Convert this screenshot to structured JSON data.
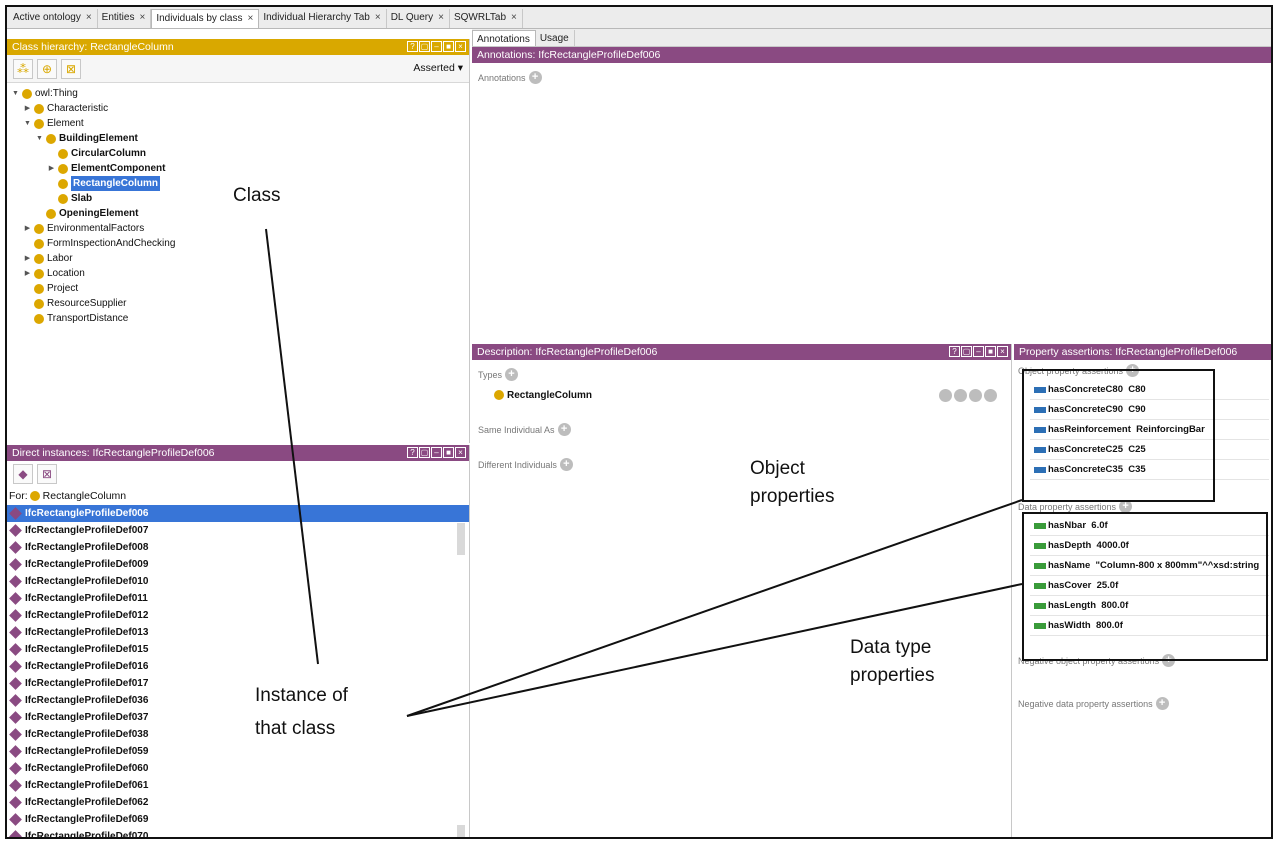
{
  "tabs": [
    {
      "label": "Active ontology"
    },
    {
      "label": "Entities"
    },
    {
      "label": "Individuals by class",
      "active": true
    },
    {
      "label": "Individual Hierarchy Tab"
    },
    {
      "label": "DL Query"
    },
    {
      "label": "SQWRLTab"
    }
  ],
  "tab_close_glyph": "×",
  "class_hierarchy": {
    "title": "Class hierarchy: RectangleColumn",
    "asserted": "Asserted ▾",
    "tree": [
      {
        "label": "owl:Thing",
        "level": 0,
        "toggle": "▼"
      },
      {
        "label": "Characteristic",
        "level": 1,
        "toggle": "▶"
      },
      {
        "label": "Element",
        "level": 1,
        "toggle": "▼"
      },
      {
        "label": "BuildingElement",
        "level": 2,
        "toggle": "▼",
        "bold": true
      },
      {
        "label": "CircularColumn",
        "level": 3,
        "bold": true
      },
      {
        "label": "ElementComponent",
        "level": 3,
        "toggle": "▶",
        "bold": true
      },
      {
        "label": "RectangleColumn",
        "level": 3,
        "bold": true,
        "selected": true
      },
      {
        "label": "Slab",
        "level": 3,
        "bold": true
      },
      {
        "label": "OpeningElement",
        "level": 2,
        "bold": true
      },
      {
        "label": "EnvironmentalFactors",
        "level": 1,
        "toggle": "▶"
      },
      {
        "label": "FormInspectionAndChecking",
        "level": 1
      },
      {
        "label": "Labor",
        "level": 1,
        "toggle": "▶"
      },
      {
        "label": "Location",
        "level": 1,
        "toggle": "▶"
      },
      {
        "label": "Project",
        "level": 1
      },
      {
        "label": "ResourceSupplier",
        "level": 1
      },
      {
        "label": "TransportDistance",
        "level": 1
      }
    ]
  },
  "direct_instances": {
    "title": "Direct instances: IfcRectangleProfileDef006",
    "for_label": "For:",
    "for_class": "RectangleColumn",
    "items": [
      "IfcRectangleProfileDef006",
      "IfcRectangleProfileDef007",
      "IfcRectangleProfileDef008",
      "IfcRectangleProfileDef009",
      "IfcRectangleProfileDef010",
      "IfcRectangleProfileDef011",
      "IfcRectangleProfileDef012",
      "IfcRectangleProfileDef013",
      "IfcRectangleProfileDef015",
      "IfcRectangleProfileDef016",
      "IfcRectangleProfileDef017",
      "IfcRectangleProfileDef036",
      "IfcRectangleProfileDef037",
      "IfcRectangleProfileDef038",
      "IfcRectangleProfileDef059",
      "IfcRectangleProfileDef060",
      "IfcRectangleProfileDef061",
      "IfcRectangleProfileDef062",
      "IfcRectangleProfileDef069",
      "IfcRectangleProfileDef070"
    ],
    "selected_index": 0
  },
  "annotations": {
    "tab1": "Annotations",
    "tab2": "Usage",
    "title": "Annotations: IfcRectangleProfileDef006",
    "label": "Annotations"
  },
  "description": {
    "title": "Description: IfcRectangleProfileDef006",
    "types_label": "Types",
    "type_value": "RectangleColumn",
    "same_label": "Same Individual As",
    "different_label": "Different Individuals"
  },
  "property_assertions": {
    "title": "Property assertions: IfcRectangleProfileDef006",
    "object_label": "Object property assertions",
    "object_props": [
      "hasConcreteC80  C80",
      "hasConcreteC90  C90",
      "hasReinforcement  ReinforcingBar",
      "hasConcreteC25  C25",
      "hasConcreteC35  C35"
    ],
    "data_label": "Data property assertions",
    "data_props": [
      "hasNbar  6.0f",
      "hasDepth  4000.0f",
      "hasName  \"Column-800 x 800mm\"^^xsd:string",
      "hasCover  25.0f",
      "hasLength  800.0f",
      "hasWidth  800.0f"
    ],
    "neg_object_label": "Negative object property assertions",
    "neg_data_label": "Negative data property assertions"
  },
  "callouts": {
    "class": "Class",
    "instance_l1": "Instance of",
    "instance_l2": "that class",
    "object_l1": "Object",
    "object_l2": "properties",
    "data_l1": "Data type",
    "data_l2": "properties"
  },
  "colors": {
    "gold_title": "#d9a800",
    "purple_title": "#8a4a82",
    "class_dot": "#dca700",
    "selection": "#3875d7",
    "object_prop": "#2c6fb5",
    "data_prop": "#3a9b3a"
  }
}
